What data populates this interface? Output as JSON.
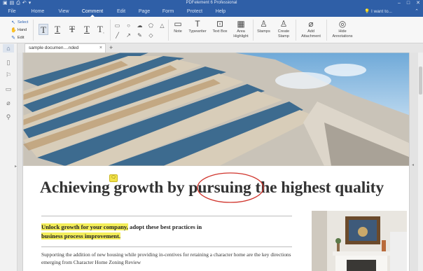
{
  "window": {
    "title": "PDFelement 6 Professional"
  },
  "quick_access": [
    {
      "icon": "app-logo-icon",
      "glyph": "▣"
    },
    {
      "icon": "save-icon",
      "glyph": "▤"
    },
    {
      "icon": "print-icon",
      "glyph": "⎙"
    },
    {
      "icon": "undo-icon",
      "glyph": "↶"
    },
    {
      "icon": "dropdown-icon",
      "glyph": "▾"
    }
  ],
  "window_controls": [
    {
      "icon": "minimize-icon",
      "glyph": "–"
    },
    {
      "icon": "maximize-icon",
      "glyph": "□"
    },
    {
      "icon": "close-icon",
      "glyph": "✕"
    }
  ],
  "menu": {
    "tabs": [
      "File",
      "Home",
      "View",
      "Comment",
      "Edit",
      "Page",
      "Form",
      "Protect",
      "Help"
    ],
    "active": "Comment",
    "search_placeholder": "I want to...",
    "search_icon": "lightbulb-icon"
  },
  "ribbon": {
    "modes": [
      {
        "label": "Select",
        "icon": "cursor-icon",
        "glyph": "↖"
      },
      {
        "label": "Hand",
        "icon": "hand-icon",
        "glyph": "✋"
      },
      {
        "label": "Edit",
        "icon": "edit-icon",
        "glyph": "✎"
      }
    ],
    "text_markup_icons": [
      "highlight-text-icon",
      "underline-text-icon",
      "strikethrough-text-icon",
      "replace-text-icon",
      "insert-text-icon"
    ],
    "shape_icons": [
      "rectangle-icon",
      "circle-icon",
      "cloud-icon",
      "polygon-icon",
      "triangle-icon",
      "line-icon",
      "arrow-icon",
      "pencil-icon",
      "eraser-icon"
    ],
    "tools": [
      {
        "label": "Note",
        "icon": "note-icon",
        "glyph": "🗨"
      },
      {
        "label": "Typewriter",
        "icon": "typewriter-icon",
        "glyph": "T"
      },
      {
        "label": "Text Box",
        "icon": "text-box-icon",
        "glyph": "⊡"
      },
      {
        "label": "Area Highlight",
        "icon": "area-highlight-icon",
        "glyph": "▦"
      },
      {
        "label": "Stamps",
        "icon": "stamp-icon",
        "glyph": "♙"
      },
      {
        "label": "Create Stamp",
        "icon": "create-stamp-icon",
        "glyph": "♙"
      },
      {
        "label": "Add Attachment",
        "icon": "paperclip-icon",
        "glyph": "⌀"
      },
      {
        "label": "Hide Annotations",
        "icon": "eye-off-icon",
        "glyph": "◎"
      }
    ]
  },
  "sidebar": {
    "items": [
      {
        "icon": "home-icon",
        "glyph": "⌂"
      },
      {
        "icon": "thumbnails-icon",
        "glyph": "▯"
      },
      {
        "icon": "bookmark-icon",
        "glyph": "⚐"
      },
      {
        "icon": "comments-icon",
        "glyph": "▭"
      },
      {
        "icon": "attachment-icon",
        "glyph": "⌀"
      },
      {
        "icon": "search-icon",
        "glyph": "⚲"
      }
    ]
  },
  "document_tab": {
    "label": "sample documen....nded",
    "close_glyph": "×",
    "new_tab_glyph": "+"
  },
  "document": {
    "heading": {
      "part1": "Achieving growth by ",
      "circled": "pursuing",
      "part2": " the highest quality"
    },
    "note_glyph": "🗨",
    "subheading": {
      "highlighted1": "Unlock growth for your company,",
      "normal": " adopt these best practices in",
      "highlighted2": "business process improvement."
    },
    "body": "Supporting the addition of new housing while providing in-centives for retaining a character home are the key directions emerging from Character Home Zoning Review"
  },
  "colors": {
    "titlebar": "#2f5fa7",
    "highlight": "#f4ee5a",
    "annotation_circle": "#d0342c"
  }
}
